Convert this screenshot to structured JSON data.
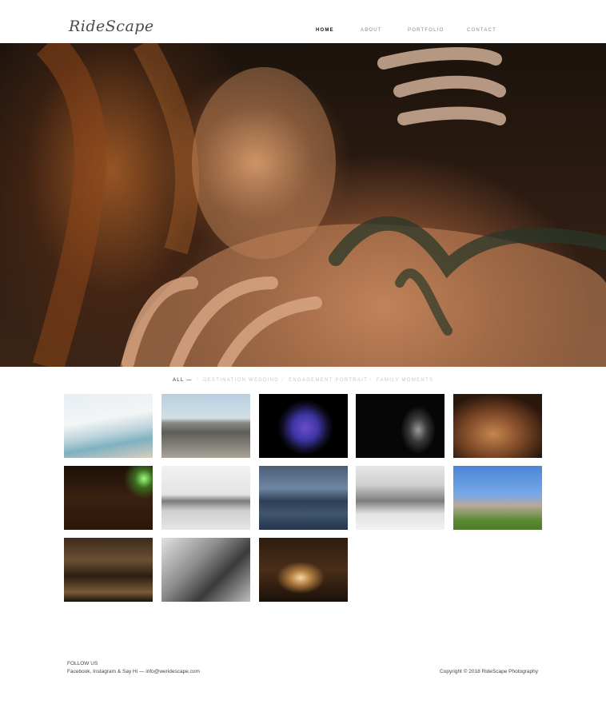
{
  "brand": {
    "logo_text": "RideScape"
  },
  "nav": {
    "items": [
      {
        "label": "HOME",
        "active": true
      },
      {
        "label": "ABOUT",
        "active": false
      },
      {
        "label": "PORTFOLIO",
        "active": false
      },
      {
        "label": "CONTACT",
        "active": false
      }
    ]
  },
  "hero": {
    "slide_count": 3,
    "active_slide": 1
  },
  "filters": {
    "items": [
      {
        "label": "ALL —",
        "active": true
      },
      {
        "label": "DESTINATION WEDDING",
        "active": false
      },
      {
        "label": "ENGAGEMENT PORTRAIT",
        "active": false
      },
      {
        "label": "FAMILY MOMENTS",
        "active": false
      }
    ],
    "separator": "/"
  },
  "gallery": {
    "item_count": 13
  },
  "footer": {
    "follow_label": "FOLLOW US",
    "links_line": "Facebook, Instagram & Say Hi — info@weridescape.com",
    "copyright": "Copyright © 2018 RideScape Photography"
  }
}
